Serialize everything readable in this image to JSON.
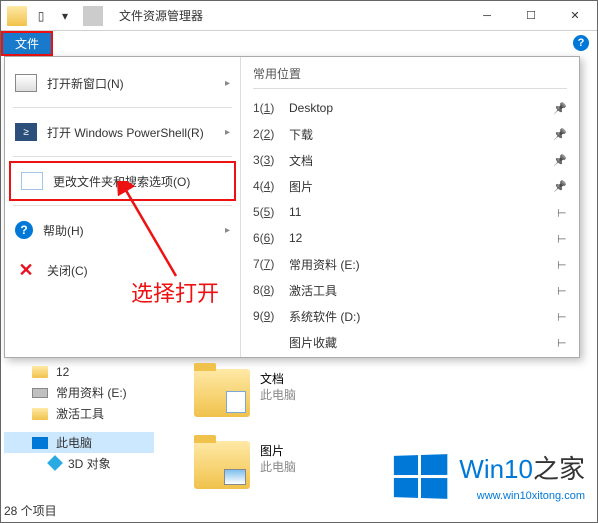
{
  "window": {
    "title": "文件资源管理器"
  },
  "ribbon": {
    "file_tab": "文件"
  },
  "file_menu": {
    "new_window": "打开新窗口(N)",
    "powershell": "打开 Windows PowerShell(R)",
    "options": "更改文件夹和搜索选项(O)",
    "help": "帮助(H)",
    "close": "关闭(C)"
  },
  "locations": {
    "header": "常用位置",
    "items": [
      {
        "key": "1(1)",
        "name": "Desktop",
        "pinned": true
      },
      {
        "key": "2(2)",
        "name": "下载",
        "pinned": true
      },
      {
        "key": "3(3)",
        "name": "文档",
        "pinned": true
      },
      {
        "key": "4(4)",
        "name": "图片",
        "pinned": true
      },
      {
        "key": "5(5)",
        "name": "11",
        "pinned": false
      },
      {
        "key": "6(6)",
        "name": "12",
        "pinned": false
      },
      {
        "key": "7(7)",
        "name": "常用资料 (E:)",
        "pinned": false
      },
      {
        "key": "8(8)",
        "name": "激活工具",
        "pinned": false
      },
      {
        "key": "9(9)",
        "name": "系统软件 (D:)",
        "pinned": false
      },
      {
        "key": "",
        "name": "图片收藏",
        "pinned": false
      }
    ]
  },
  "annotation": {
    "text": "选择打开"
  },
  "sidebar": {
    "items": [
      {
        "label": "12",
        "icon": "folder"
      },
      {
        "label": "常用资料 (E:)",
        "icon": "drive"
      },
      {
        "label": "激活工具",
        "icon": "folder"
      }
    ],
    "this_pc": "此电脑",
    "sub": "3D 对象"
  },
  "filegrid": {
    "items": [
      {
        "title": "文档",
        "sub": "此电脑",
        "overlay": "doc"
      },
      {
        "title": "图片",
        "sub": "此电脑",
        "overlay": "pic"
      }
    ]
  },
  "status": {
    "count": "28 个项目"
  },
  "watermark": {
    "brand_a": "Win10",
    "brand_b": "之家",
    "url": "www.win10xitong.com"
  }
}
